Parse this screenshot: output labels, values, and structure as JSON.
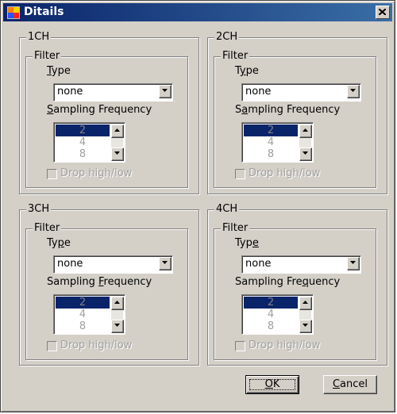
{
  "window": {
    "title": "Ditails"
  },
  "channels": [
    {
      "title": "1CH",
      "filter_label": "Filter",
      "type_label_pre": "",
      "type_label_u": "T",
      "type_label_post": "ype",
      "type_value": "none",
      "freq_label_pre": "",
      "freq_label_u": "S",
      "freq_label_post": "ampling Frequency",
      "freq_options": [
        "2",
        "4",
        "8"
      ],
      "freq_selected": "2",
      "drop_label": "Drop high/low",
      "drop_checked": false
    },
    {
      "title": "2CH",
      "filter_label": "Filter",
      "type_label_pre": "T",
      "type_label_u": "y",
      "type_label_post": "pe",
      "type_value": "none",
      "freq_label_pre": "S",
      "freq_label_u": "a",
      "freq_label_post": "mpling Frequency",
      "freq_options": [
        "2",
        "4",
        "8"
      ],
      "freq_selected": "2",
      "drop_label": "Drop high/low",
      "drop_checked": false
    },
    {
      "title": "3CH",
      "filter_label": "Filter",
      "type_label_pre": "Ty",
      "type_label_u": "p",
      "type_label_post": "e",
      "type_value": "none",
      "freq_label_pre": "Sampling ",
      "freq_label_u": "F",
      "freq_label_post": "requency",
      "freq_options": [
        "2",
        "4",
        "8"
      ],
      "freq_selected": "2",
      "drop_label": "Drop high/low",
      "drop_checked": false
    },
    {
      "title": "4CH",
      "filter_label": "Filter",
      "type_label_pre": "Typ",
      "type_label_u": "e",
      "type_label_post": "",
      "type_value": "none",
      "freq_label_pre": "Sampling Fre",
      "freq_label_u": "q",
      "freq_label_post": "uency",
      "freq_options": [
        "2",
        "4",
        "8"
      ],
      "freq_selected": "2",
      "drop_label": "Drop high/low",
      "drop_checked": false
    }
  ],
  "buttons": {
    "ok_pre": "",
    "ok_u": "O",
    "ok_post": "K",
    "cancel_pre": "",
    "cancel_u": "C",
    "cancel_post": "ancel"
  },
  "colors": {
    "titlebar_start": "#0a246a",
    "titlebar_end": "#3a6ea5",
    "face": "#d4d0c8",
    "selection": "#0a246a"
  },
  "icons": {
    "app": "app-window-icon",
    "close": "close-icon",
    "dropdown": "chevron-down-icon",
    "scroll_up": "arrow-up-icon",
    "scroll_down": "arrow-down-icon"
  }
}
